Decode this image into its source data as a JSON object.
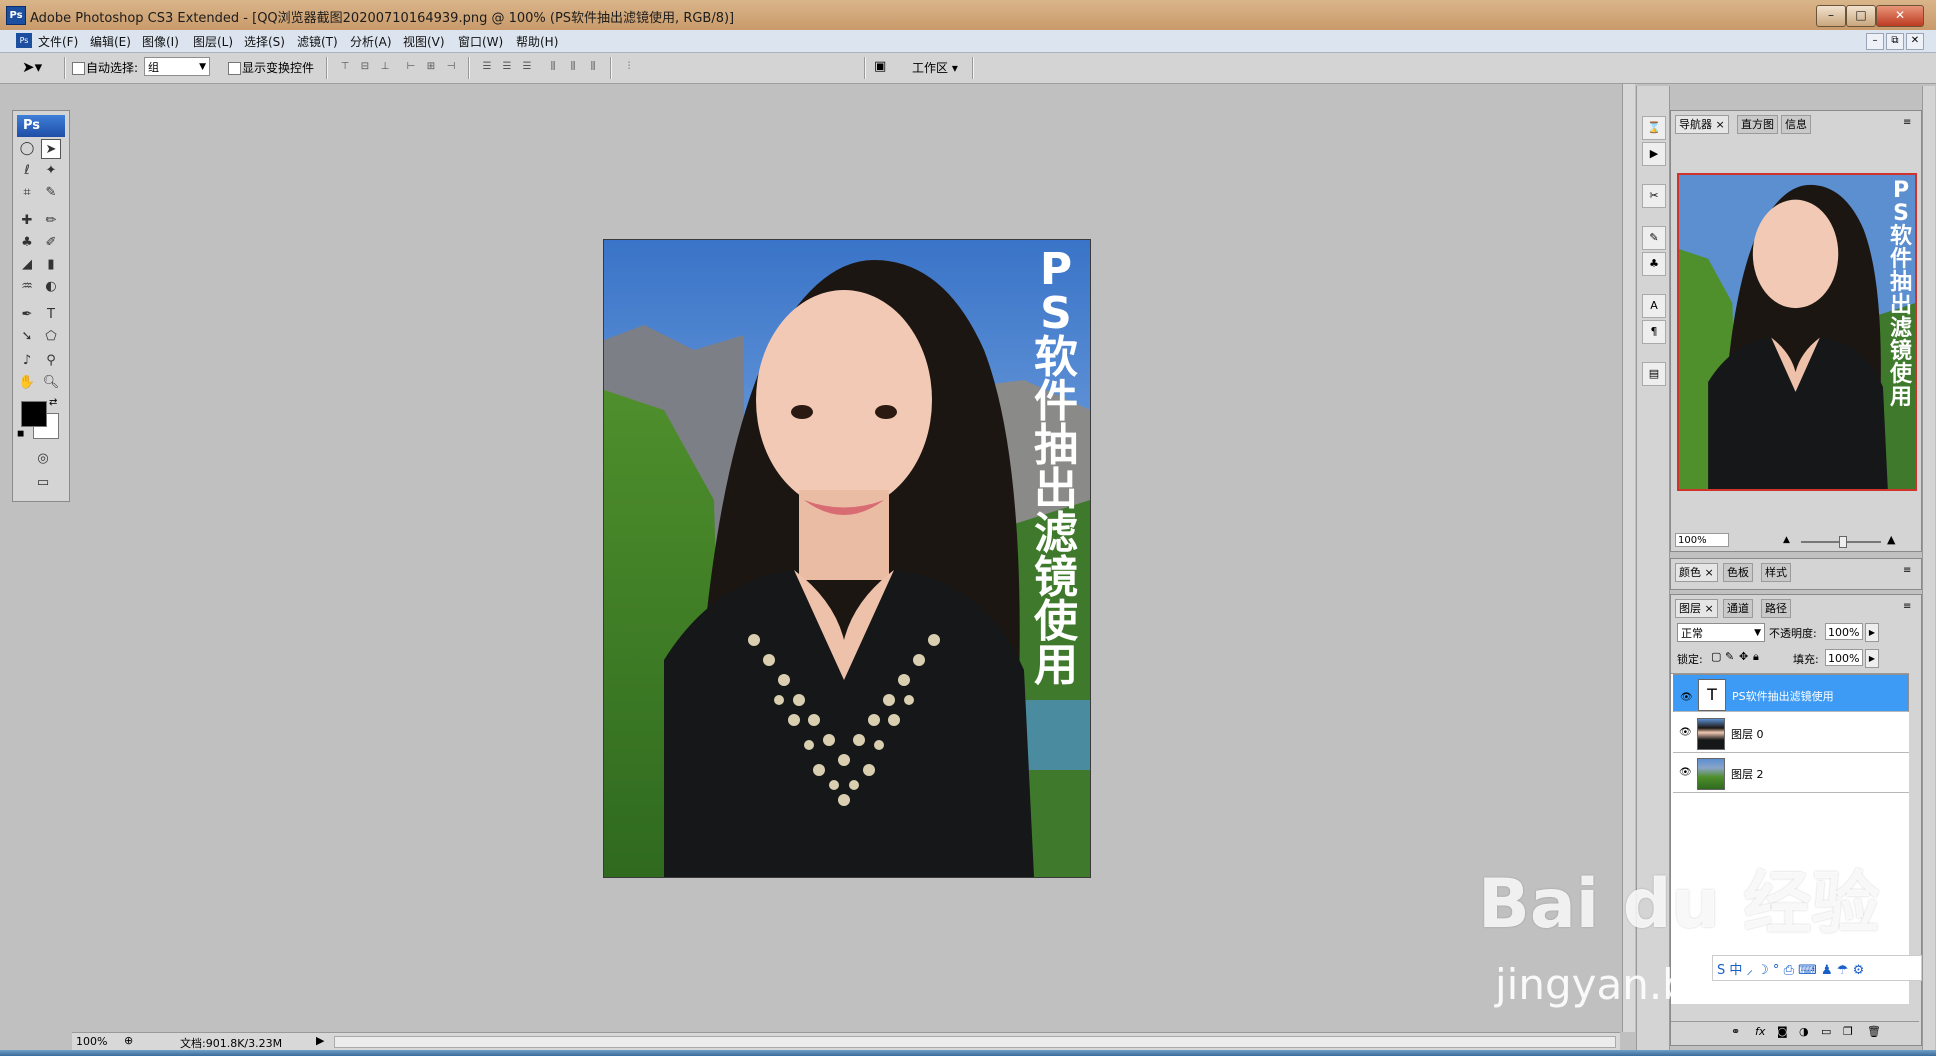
{
  "window": {
    "title": "Adobe Photoshop CS3 Extended - [QQ浏览器截图20200710164939.png @ 100% (PS软件抽出滤镜使用, RGB/8)]",
    "minimize_label": "–",
    "maximize_label": "□",
    "close_label": "✕"
  },
  "menu": {
    "items": [
      "文件(F)",
      "编辑(E)",
      "图像(I)",
      "图层(L)",
      "选择(S)",
      "滤镜(T)",
      "分析(A)",
      "视图(V)",
      "窗口(W)",
      "帮助(H)"
    ],
    "doc_min": "–",
    "doc_restore": "⧉",
    "doc_close": "✕"
  },
  "options": {
    "auto_select_label": "自动选择:",
    "auto_select_value": "组",
    "show_transform_label": "显示变换控件",
    "workspace_label": "工作区 ▾"
  },
  "toolbox": {
    "ps_label": "Ps"
  },
  "canvas": {
    "overlay_text": "PS软件抽出滤镜使用"
  },
  "status": {
    "zoom": "100%",
    "doc_info": "文档:901.8K/3.23M"
  },
  "navigator": {
    "tabs": [
      "导航器",
      "直方图",
      "信息"
    ],
    "zoom": "100%"
  },
  "color_panel": {
    "tabs": [
      "颜色",
      "色板",
      "样式"
    ]
  },
  "layers": {
    "tabs": [
      "图层",
      "通道",
      "路径"
    ],
    "blend_mode": "正常",
    "opacity_label": "不透明度:",
    "opacity_value": "100%",
    "lock_label": "锁定:",
    "fill_label": "填充:",
    "fill_value": "100%",
    "items": [
      {
        "name": "PS软件抽出滤镜使用",
        "type_glyph": "T"
      },
      {
        "name": "图层 0"
      },
      {
        "name": "图层 2"
      }
    ]
  },
  "watermark": {
    "main": "Bai du 经验",
    "sub": "jingyan.baidu.com"
  },
  "ime": {
    "text": "S 中 ⸝ ☽ ° ⎙ ⌨ ♟ ☂ ⚙"
  }
}
